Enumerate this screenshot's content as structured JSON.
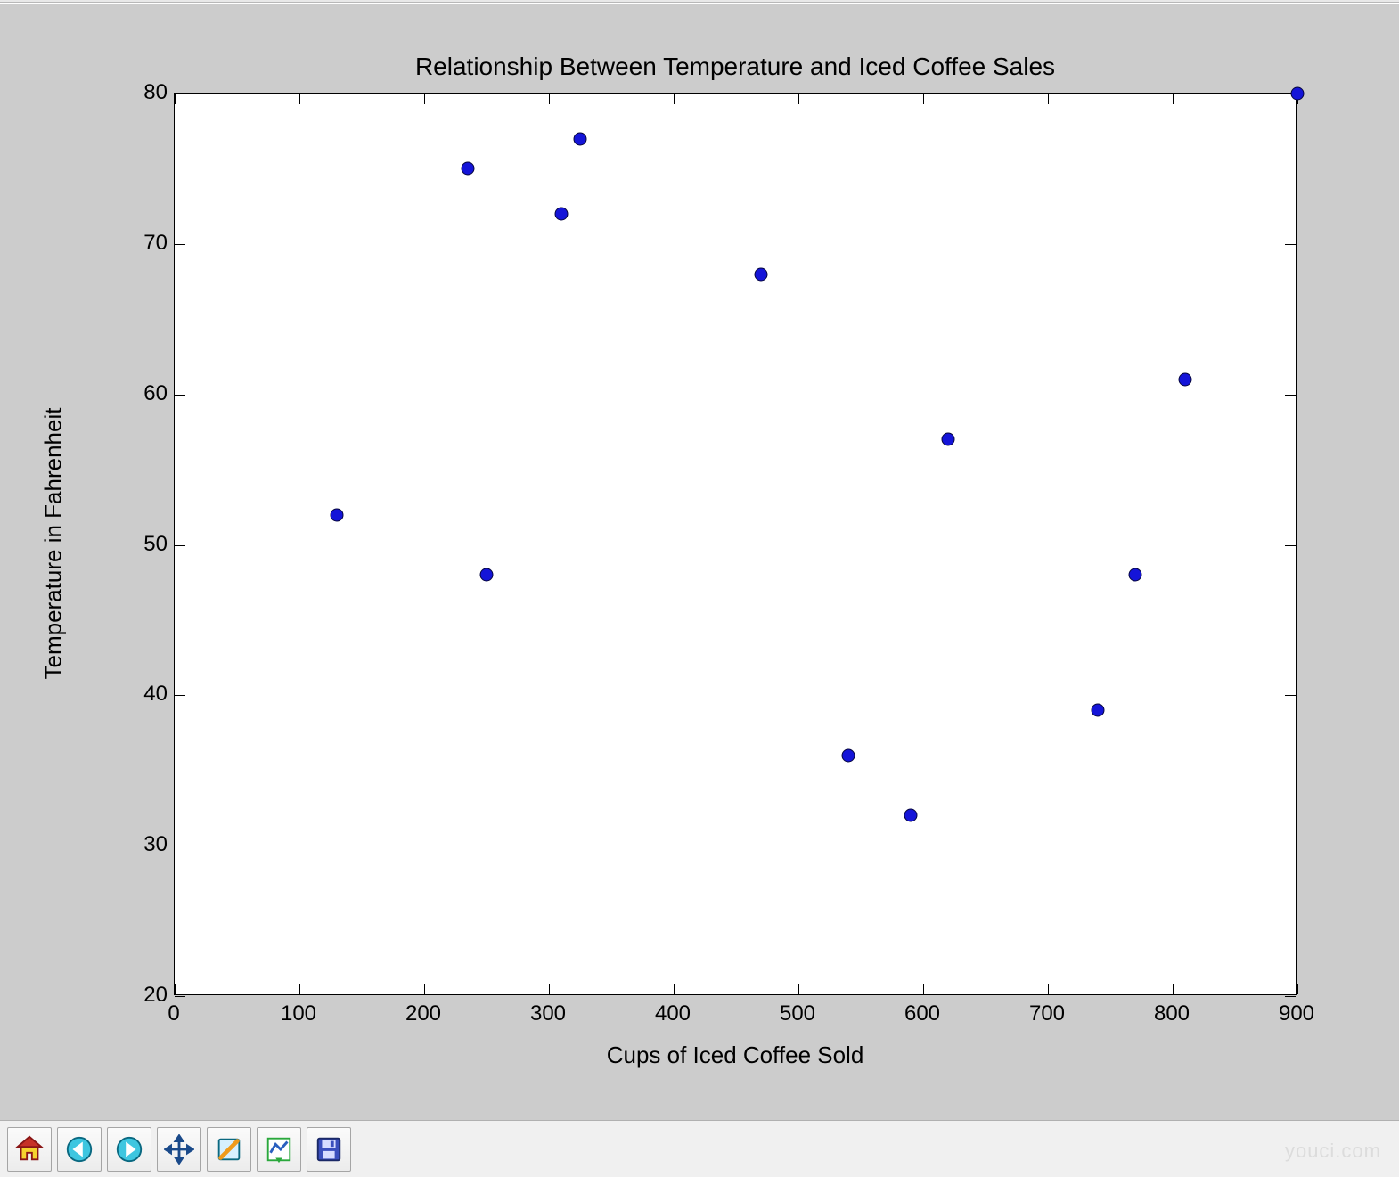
{
  "chart_data": {
    "type": "scatter",
    "title": "Relationship Between Temperature and Iced Coffee Sales",
    "xlabel": "Cups of Iced Coffee Sold",
    "ylabel": "Temperature in Fahrenheit",
    "xlim": [
      0,
      900
    ],
    "ylim": [
      20,
      80
    ],
    "x_ticks": [
      0,
      100,
      200,
      300,
      400,
      500,
      600,
      700,
      800,
      900
    ],
    "y_ticks": [
      20,
      30,
      40,
      50,
      60,
      70,
      80
    ],
    "points": [
      {
        "x": 130,
        "y": 52
      },
      {
        "x": 235,
        "y": 75
      },
      {
        "x": 250,
        "y": 48
      },
      {
        "x": 310,
        "y": 72
      },
      {
        "x": 325,
        "y": 77
      },
      {
        "x": 470,
        "y": 68
      },
      {
        "x": 540,
        "y": 36
      },
      {
        "x": 590,
        "y": 32
      },
      {
        "x": 620,
        "y": 57
      },
      {
        "x": 740,
        "y": 39
      },
      {
        "x": 770,
        "y": 48
      },
      {
        "x": 810,
        "y": 61
      },
      {
        "x": 900,
        "y": 80
      }
    ]
  },
  "toolbar": {
    "home_label": "Reset view",
    "back_label": "Back",
    "forward_label": "Forward",
    "pan_label": "Pan",
    "zoom_label": "Zoom",
    "subplots_label": "Configure subplots",
    "save_label": "Save figure"
  },
  "watermark": "youci.com"
}
